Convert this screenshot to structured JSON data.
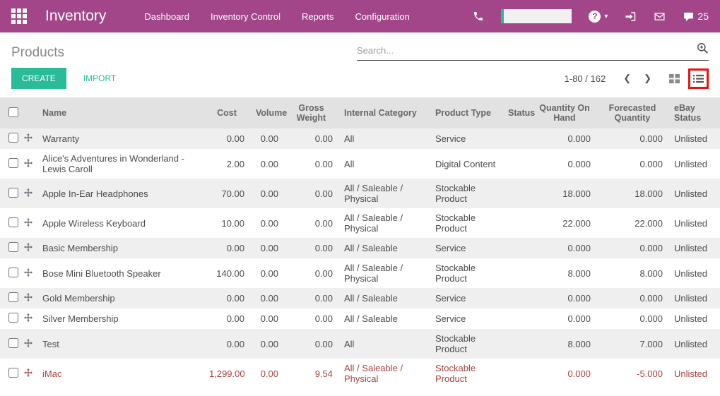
{
  "colors": {
    "header_bg": "#a24689",
    "accent": "#2abb98",
    "danger": "#a8433f",
    "annotation": "#ec0f0f"
  },
  "header": {
    "brand": "Inventory",
    "nav": {
      "dashboard": "Dashboard",
      "inventory_control": "Inventory Control",
      "reports": "Reports",
      "configuration": "Configuration"
    },
    "help_glyph": "?",
    "caret_glyph": "▾",
    "message_count": "25"
  },
  "control_panel": {
    "title": "Products",
    "search_placeholder": "Search...",
    "create_label": "CREATE",
    "import_label": "IMPORT",
    "pager_value": "1-80 / 162",
    "prev_glyph": "❮",
    "next_glyph": "❯"
  },
  "table": {
    "columns": [
      "Name",
      "Cost",
      "Volume",
      "Gross Weight",
      "Internal Category",
      "Product Type",
      "Status",
      "Quantity On Hand",
      "Forecasted Quantity",
      "eBay Status"
    ],
    "rows": [
      {
        "name": "Warranty",
        "cost": "0.00",
        "volume": "0.00",
        "gross_weight": "0.00",
        "category": "All",
        "type": "Service",
        "status": "",
        "qty_on_hand": "0.000",
        "forecasted": "0.000",
        "ebay": "Unlisted",
        "danger": false
      },
      {
        "name": "Alice's Adventures in Wonderland - Lewis Caroll",
        "cost": "2.00",
        "volume": "0.00",
        "gross_weight": "0.00",
        "category": "All",
        "type": "Digital Content",
        "status": "",
        "qty_on_hand": "0.000",
        "forecasted": "0.000",
        "ebay": "Unlisted",
        "danger": false
      },
      {
        "name": "Apple In-Ear Headphones",
        "cost": "70.00",
        "volume": "0.00",
        "gross_weight": "0.00",
        "category": "All / Saleable / Physical",
        "type": "Stockable Product",
        "status": "",
        "qty_on_hand": "18.000",
        "forecasted": "18.000",
        "ebay": "Unlisted",
        "danger": false
      },
      {
        "name": "Apple Wireless Keyboard",
        "cost": "10.00",
        "volume": "0.00",
        "gross_weight": "0.00",
        "category": "All / Saleable / Physical",
        "type": "Stockable Product",
        "status": "",
        "qty_on_hand": "22.000",
        "forecasted": "22.000",
        "ebay": "Unlisted",
        "danger": false
      },
      {
        "name": "Basic Membership",
        "cost": "0.00",
        "volume": "0.00",
        "gross_weight": "0.00",
        "category": "All / Saleable",
        "type": "Service",
        "status": "",
        "qty_on_hand": "0.000",
        "forecasted": "0.000",
        "ebay": "Unlisted",
        "danger": false
      },
      {
        "name": "Bose Mini Bluetooth Speaker",
        "cost": "140.00",
        "volume": "0.00",
        "gross_weight": "0.00",
        "category": "All / Saleable / Physical",
        "type": "Stockable Product",
        "status": "",
        "qty_on_hand": "8.000",
        "forecasted": "8.000",
        "ebay": "Unlisted",
        "danger": false
      },
      {
        "name": "Gold Membership",
        "cost": "0.00",
        "volume": "0.00",
        "gross_weight": "0.00",
        "category": "All / Saleable",
        "type": "Service",
        "status": "",
        "qty_on_hand": "0.000",
        "forecasted": "0.000",
        "ebay": "Unlisted",
        "danger": false
      },
      {
        "name": "Silver Membership",
        "cost": "0.00",
        "volume": "0.00",
        "gross_weight": "0.00",
        "category": "All / Saleable",
        "type": "Service",
        "status": "",
        "qty_on_hand": "0.000",
        "forecasted": "0.000",
        "ebay": "Unlisted",
        "danger": false
      },
      {
        "name": "Test",
        "cost": "0.00",
        "volume": "0.00",
        "gross_weight": "0.00",
        "category": "All",
        "type": "Stockable Product",
        "status": "",
        "qty_on_hand": "8.000",
        "forecasted": "7.000",
        "ebay": "Unlisted",
        "danger": false
      },
      {
        "name": "iMac",
        "cost": "1,299.00",
        "volume": "0.00",
        "gross_weight": "9.54",
        "category": "All / Saleable / Physical",
        "type": "Stockable Product",
        "status": "",
        "qty_on_hand": "0.000",
        "forecasted": "-5.000",
        "ebay": "Unlisted",
        "danger": true
      }
    ]
  }
}
